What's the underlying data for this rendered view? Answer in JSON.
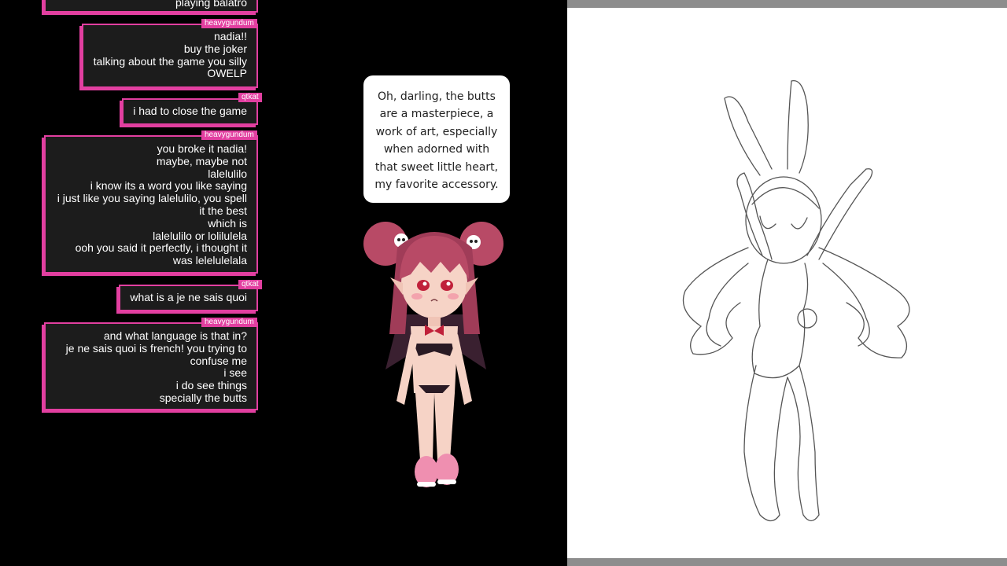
{
  "chat": {
    "partial_top": "playing balatro",
    "messages": [
      {
        "user": "heavygundum",
        "lines": [
          "nadia!!",
          "buy the joker",
          "talking about the game you silly",
          "OWELP"
        ]
      },
      {
        "user": "qtkat",
        "lines": [
          "i had to close the game"
        ]
      },
      {
        "user": "heavygundum",
        "lines": [
          "you broke it nadia!",
          "maybe, maybe not",
          "lalelulilo",
          "i know its a word you like saying",
          "i just like you saying lalelulilo, you spell it the best",
          "which is",
          "lalelulilo or lolilulela",
          "ooh you said it perfectly, i thought it was lelelulelala"
        ]
      },
      {
        "user": "qtkat",
        "lines": [
          "what is a je ne sais quoi"
        ]
      },
      {
        "user": "heavygundum",
        "lines": [
          "and what language is that in?",
          "je ne sais quoi is french! you trying to confuse me",
          "i see",
          "i do see things",
          "specially the butts"
        ]
      }
    ]
  },
  "speech_bubble": {
    "text": "Oh, darling, the butts are a masterpiece, a work of art, especially when adorned with that sweet little heart, my favorite accessory."
  },
  "colors": {
    "accent": "#e23fa0",
    "chat_bg": "#1c1c1c",
    "page_bg": "#000000",
    "canvas_bg": "#ffffff"
  }
}
